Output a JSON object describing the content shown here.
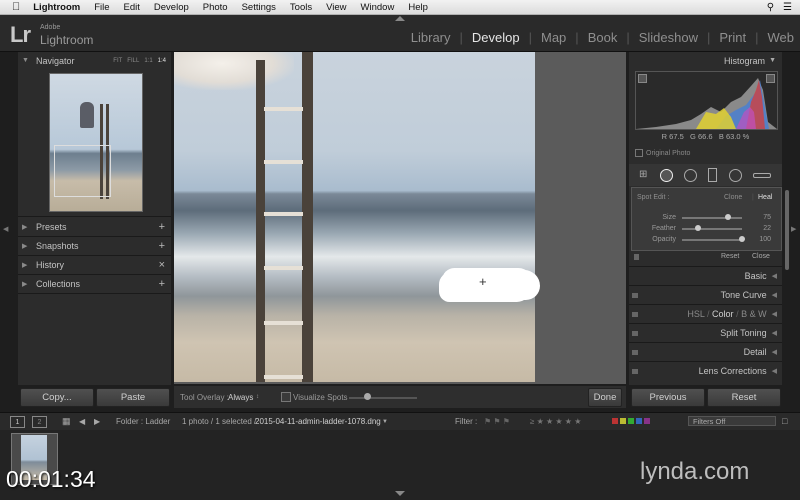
{
  "menubar": {
    "app": "Lightroom",
    "items": [
      "File",
      "Edit",
      "Develop",
      "Photo",
      "Settings",
      "Tools",
      "View",
      "Window",
      "Help"
    ]
  },
  "identity": {
    "logo": "Lr",
    "adobe": "Adobe",
    "product": "Lightroom"
  },
  "modules": [
    "Library",
    "Develop",
    "Map",
    "Book",
    "Slideshow",
    "Print",
    "Web"
  ],
  "active_module": "Develop",
  "left_panel": {
    "navigator": {
      "title": "Navigator",
      "zoom_options": [
        "FIT",
        "FILL",
        "1:1",
        "1:4"
      ],
      "active_zoom": "1:4"
    },
    "sections": [
      {
        "label": "Presets",
        "action": "+"
      },
      {
        "label": "Snapshots",
        "action": "+"
      },
      {
        "label": "History",
        "action": "×"
      },
      {
        "label": "Collections",
        "action": "+"
      }
    ],
    "copy_button": "Copy...",
    "paste_button": "Paste"
  },
  "toolbar": {
    "overlay_label": "Tool Overlay :",
    "overlay_value": "Always",
    "visualize_label": "Visualize Spots",
    "done_button": "Done"
  },
  "right_panel": {
    "histogram_title": "Histogram",
    "readout": {
      "r_label": "R",
      "r": "67.5",
      "g_label": "G",
      "g": "66.6",
      "b_label": "B",
      "b": "63.0",
      "unit": "%"
    },
    "original_photo": "Original Photo",
    "spot": {
      "label": "Spot Edit :",
      "modes": [
        "Clone",
        "Heal"
      ],
      "active_mode": "Heal",
      "sliders": [
        {
          "label": "Size",
          "value": "75",
          "fraction": 0.75
        },
        {
          "label": "Feather",
          "value": "22",
          "fraction": 0.22
        },
        {
          "label": "Opacity",
          "value": "100",
          "fraction": 1.0
        }
      ],
      "reset": "Reset",
      "close": "Close"
    },
    "sections": [
      {
        "label": "Basic"
      },
      {
        "label": "Tone Curve"
      },
      {
        "label": "HSL / Color / B & W"
      },
      {
        "label": "Split Toning"
      },
      {
        "label": "Detail"
      },
      {
        "label": "Lens Corrections"
      }
    ],
    "hsl_parts": [
      "HSL",
      "Color",
      "B & W"
    ],
    "previous_button": "Previous",
    "reset_button": "Reset"
  },
  "filmstrip_bar": {
    "page1": "1",
    "page2": "2",
    "folder": "Folder : Ladder",
    "selection": "1 photo / 1 selected /",
    "filename": "2015-04-11-admin-ladder-1078.dng",
    "filter_label": "Filter :",
    "filters_off": "Filters Off"
  },
  "overlay": {
    "timer": "00:01:34",
    "watermark": "lynda.com"
  },
  "colors": {
    "accent": "#e6e6e6",
    "panel": "#2c2c2c",
    "background": "#1e1e1e"
  }
}
